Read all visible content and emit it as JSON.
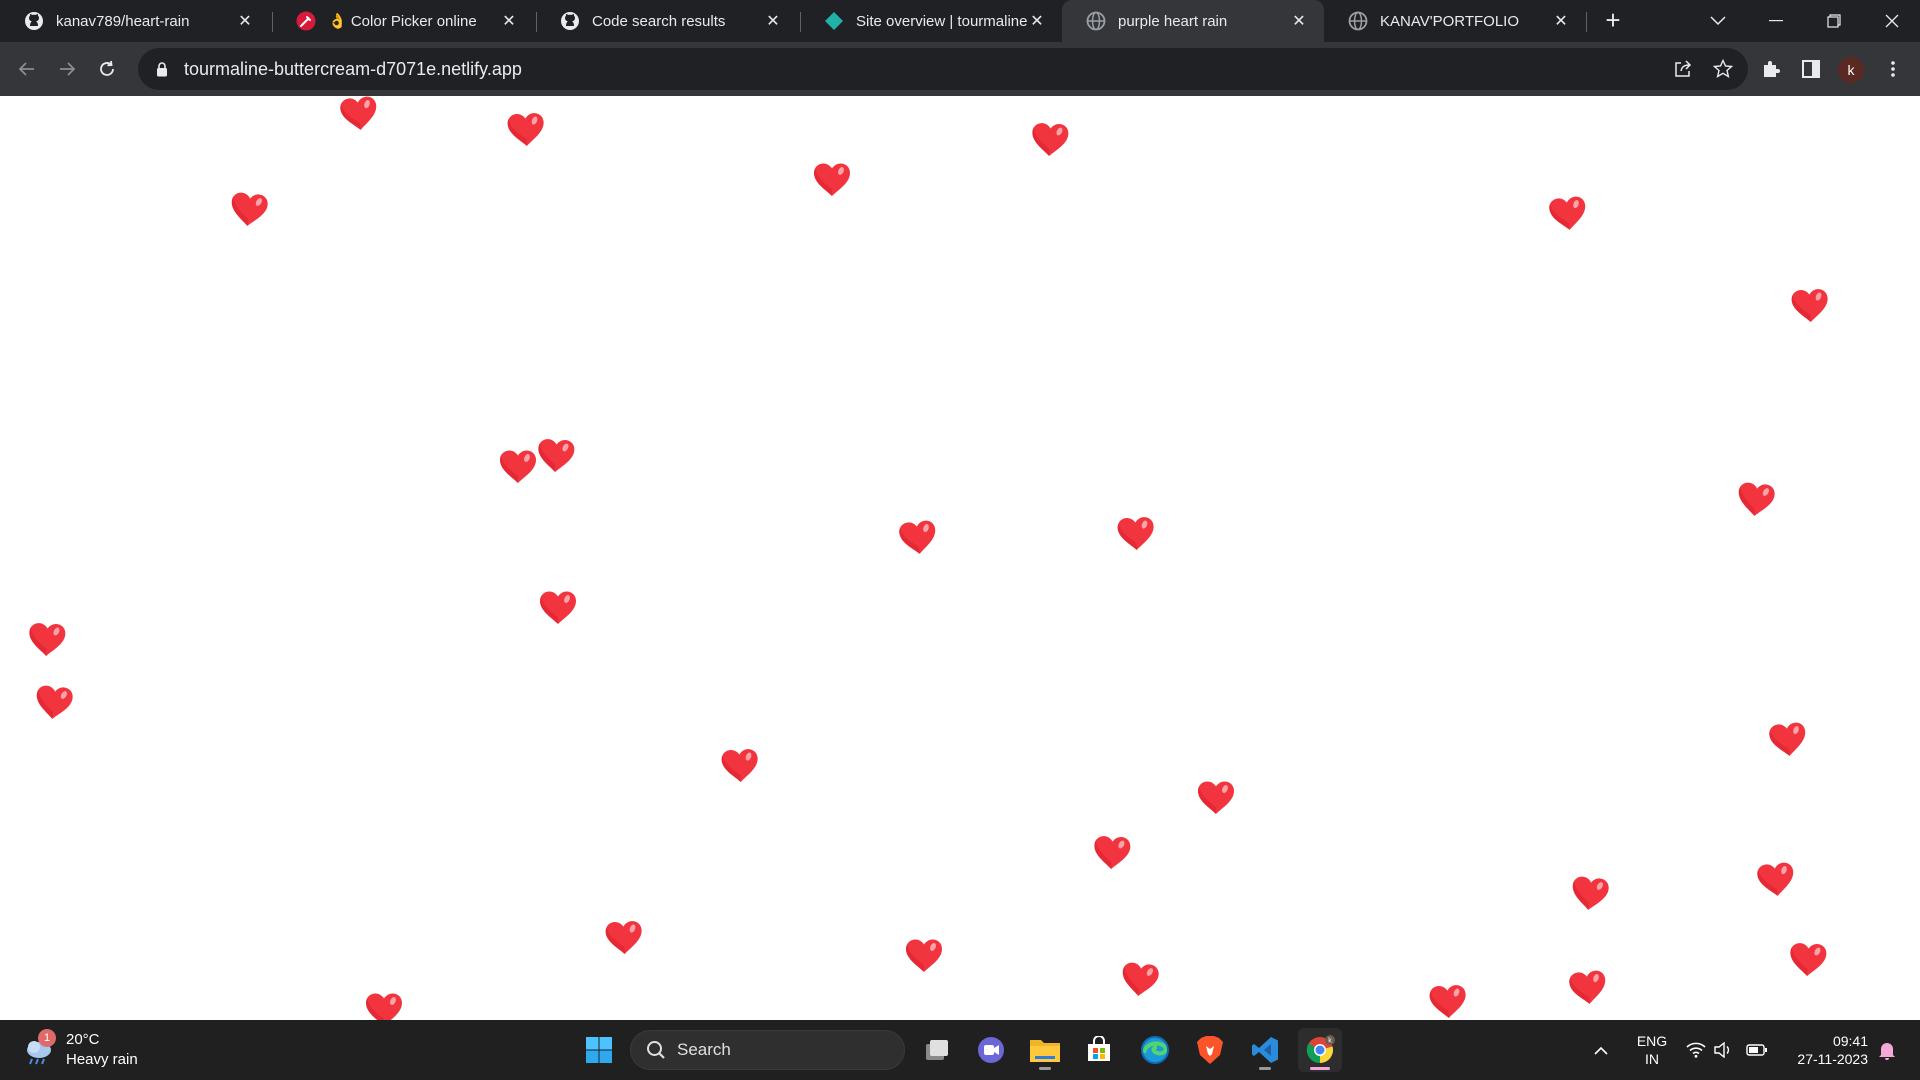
{
  "browser": {
    "tabs": [
      {
        "title": "kanav789/heart-rain",
        "favicon": "github-icon",
        "active": false
      },
      {
        "title": "👌 Color Picker online | HE",
        "favicon": "color-picker-icon",
        "active": false
      },
      {
        "title": "Code search results",
        "favicon": "github-icon",
        "active": false
      },
      {
        "title": "Site overview | tourmaline-",
        "favicon": "netlify-icon",
        "active": false
      },
      {
        "title": "purple heart rain",
        "favicon": "globe-icon",
        "active": true
      },
      {
        "title": "KANAV'PORTFOLIO",
        "favicon": "globe-icon",
        "active": false
      }
    ],
    "url": "tourmaline-buttercream-d7071e.netlify.app",
    "profile_initial": "k",
    "colors": {
      "tabstrip": "#202124",
      "toolbar": "#35363a",
      "omnibox": "#202124"
    }
  },
  "page": {
    "heart_color": "#f2343f",
    "heart_count": 34
  },
  "taskbar": {
    "weather": {
      "temp": "20°C",
      "condition": "Heavy rain",
      "badge": "1"
    },
    "search_placeholder": "Search",
    "apps": [
      "start-button",
      "task-view",
      "teams-chat",
      "file-explorer",
      "microsoft-store",
      "edge",
      "brave",
      "vscode",
      "chrome"
    ],
    "chrome_badge": "k",
    "language": {
      "line1": "ENG",
      "line2": "IN"
    },
    "time": "09:41",
    "date": "27-11-2023"
  }
}
